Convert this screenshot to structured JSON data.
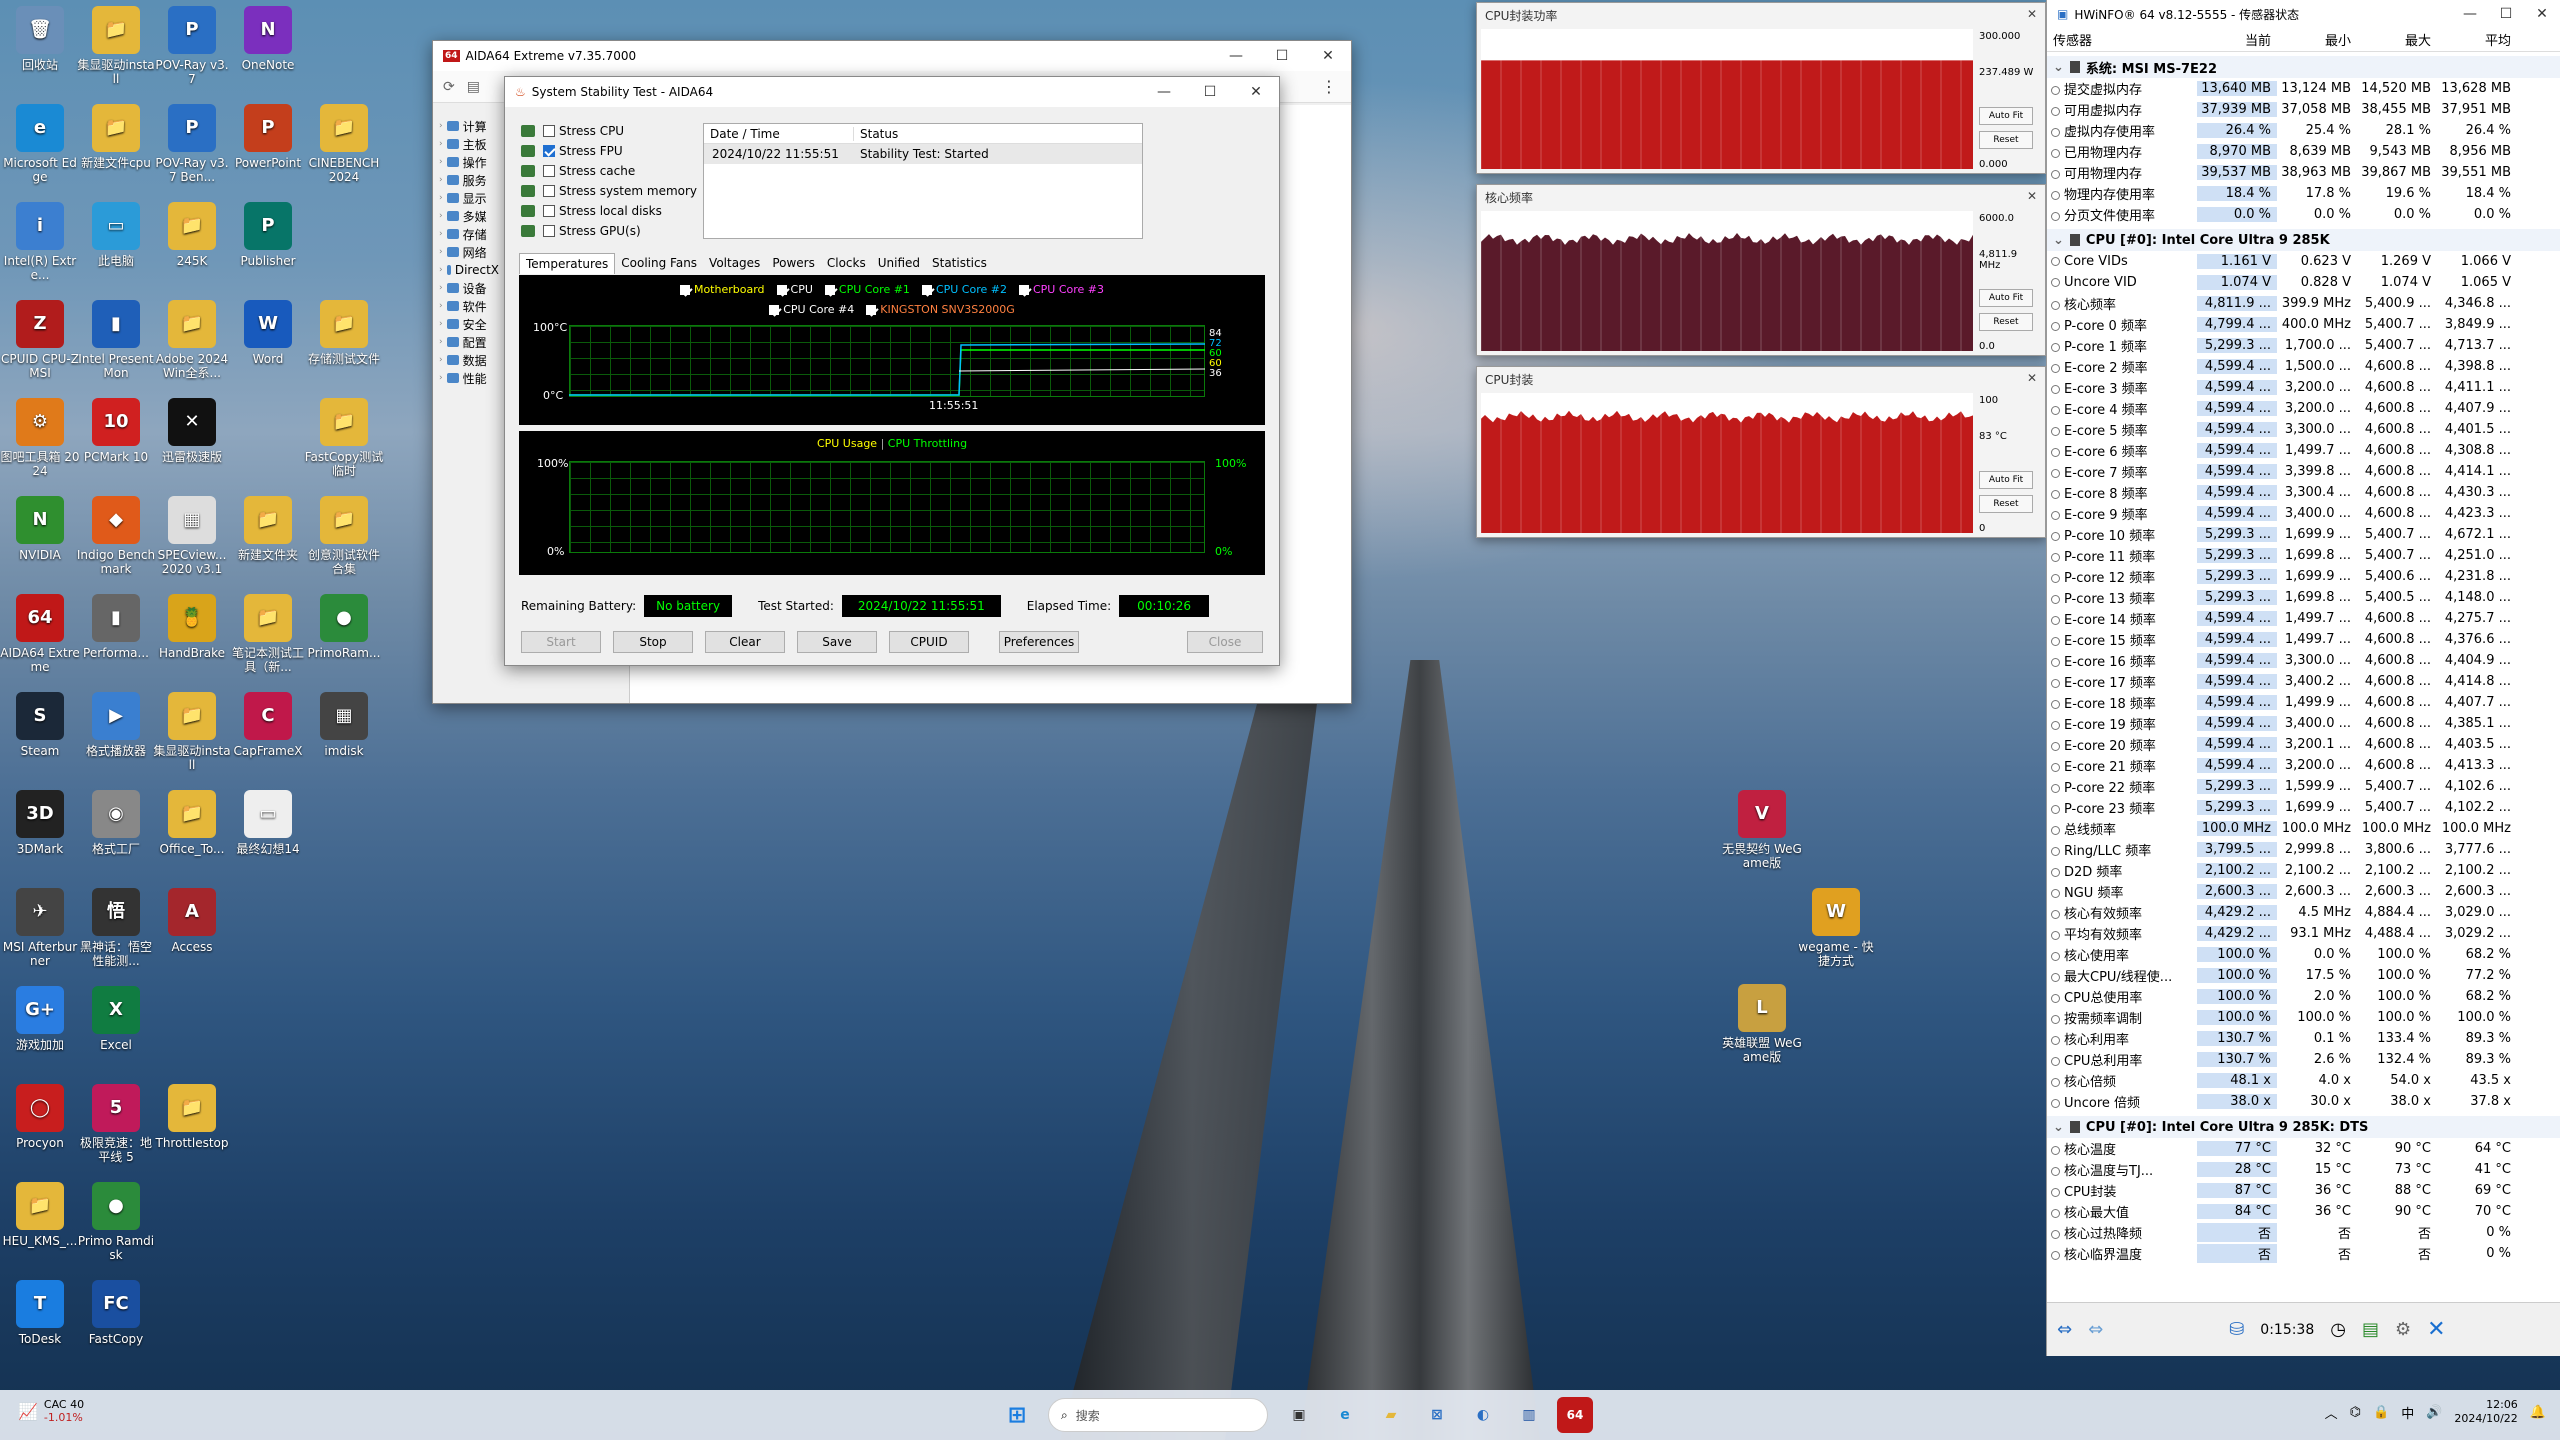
{
  "desktop_icons": [
    {
      "label": "回收站",
      "color": "#6a8fb8",
      "glyph": "🗑"
    },
    {
      "label": "集显驱动install",
      "color": "#e4b73a",
      "glyph": "📁"
    },
    {
      "label": "POV-Ray v3.7",
      "color": "#2a6fc4",
      "glyph": "P"
    },
    {
      "label": "OneNote",
      "color": "#7b2fbe",
      "glyph": "N"
    },
    {
      "label": "Microsoft Edge",
      "color": "#1a8ad4",
      "glyph": "e"
    },
    {
      "label": "新建文件cpu",
      "color": "#e4b73a",
      "glyph": "📁"
    },
    {
      "label": "POV-Ray v3.7 Ben...",
      "color": "#2a6fc4",
      "glyph": "P"
    },
    {
      "label": "PowerPoint",
      "color": "#c43e1c",
      "glyph": "P"
    },
    {
      "label": "CINEBENCH 2024",
      "color": "#e4b73a",
      "glyph": "📁"
    },
    {
      "label": "Intel(R) Extre...",
      "color": "#3c7fd0",
      "glyph": "i"
    },
    {
      "label": "此电脑",
      "color": "#2b9bd8",
      "glyph": "▭"
    },
    {
      "label": "245K",
      "color": "#e4b73a",
      "glyph": "📁"
    },
    {
      "label": "Publisher",
      "color": "#077568",
      "glyph": "P"
    },
    {
      "label": "CPUID CPU-Z MSI",
      "color": "#b11c1c",
      "glyph": "Z"
    },
    {
      "label": "Intel PresentMon",
      "color": "#1f5fb8",
      "glyph": "▮"
    },
    {
      "label": "Adobe 2024 Win全系...",
      "color": "#e4b73a",
      "glyph": "📁"
    },
    {
      "label": "Word",
      "color": "#185abd",
      "glyph": "W"
    },
    {
      "label": "存储测试文件",
      "color": "#e4b73a",
      "glyph": "📁"
    },
    {
      "label": "图吧工具箱 2024",
      "color": "#e07a1a",
      "glyph": "⚙"
    },
    {
      "label": "PCMark 10",
      "color": "#d02020",
      "glyph": "10"
    },
    {
      "label": "迅雷极速版",
      "color": "#111",
      "glyph": "✕"
    },
    {
      "label": "FastCopy测试临时",
      "color": "#e4b73a",
      "glyph": "📁"
    },
    {
      "label": "NVIDIA",
      "color": "#2f8f2f",
      "glyph": "N"
    },
    {
      "label": "Indigo Benchmark",
      "color": "#e05a1a",
      "glyph": "◆"
    },
    {
      "label": "SPECview... 2020 v3.1",
      "color": "#ddd",
      "glyph": "▦"
    },
    {
      "label": "新建文件夹",
      "color": "#e4b73a",
      "glyph": "📁"
    },
    {
      "label": "创意测试软件合集",
      "color": "#e4b73a",
      "glyph": "📁"
    },
    {
      "label": "AIDA64 Extreme",
      "color": "#c01818",
      "glyph": "64"
    },
    {
      "label": "Performa...",
      "color": "#666",
      "glyph": "▮"
    },
    {
      "label": "HandBrake",
      "color": "#d9a41a",
      "glyph": "🍍"
    },
    {
      "label": "笔记本测试工具（新...",
      "color": "#e4b73a",
      "glyph": "📁"
    },
    {
      "label": "PrimoRam...",
      "color": "#2b8b3b",
      "glyph": "●"
    },
    {
      "label": "Steam",
      "color": "#1b2838",
      "glyph": "S"
    },
    {
      "label": "格式播放器",
      "color": "#3a7fd0",
      "glyph": "▶"
    },
    {
      "label": "集显驱动install",
      "color": "#e4b73a",
      "glyph": "📁"
    },
    {
      "label": "CapFrameX",
      "color": "#c0184a",
      "glyph": "C"
    },
    {
      "label": "imdisk",
      "color": "#444",
      "glyph": "▦"
    },
    {
      "label": "3DMark",
      "color": "#222",
      "glyph": "3D"
    },
    {
      "label": "格式工厂",
      "color": "#888",
      "glyph": "◉"
    },
    {
      "label": "Office_To...",
      "color": "#e4b73a",
      "glyph": "📁"
    },
    {
      "label": "最终幻想14",
      "color": "#eee",
      "glyph": "▭"
    },
    {
      "label": "MSI Afterburner",
      "color": "#444",
      "glyph": "✈"
    },
    {
      "label": "黑神话：悟空 性能测...",
      "color": "#333",
      "glyph": "悟"
    },
    {
      "label": "Access",
      "color": "#a4262c",
      "glyph": "A"
    },
    {
      "label": "游戏加加",
      "color": "#2a7de1",
      "glyph": "G+"
    },
    {
      "label": "Excel",
      "color": "#107c41",
      "glyph": "X"
    },
    {
      "label": "Procyon",
      "color": "#c81e1e",
      "glyph": "◯"
    },
    {
      "label": "极限竞速：地平线 5",
      "color": "#c01a5a",
      "glyph": "5"
    },
    {
      "label": "Throttlestop",
      "color": "#e4b73a",
      "glyph": "📁"
    },
    {
      "label": "HEU_KMS_...",
      "color": "#e4b73a",
      "glyph": "📁"
    },
    {
      "label": "Primo Ramdisk",
      "color": "#2b8b3b",
      "glyph": "●"
    },
    {
      "label": "ToDesk",
      "color": "#1a7de0",
      "glyph": "T"
    },
    {
      "label": "FastCopy",
      "color": "#1a4fa0",
      "glyph": "FC"
    },
    {
      "label": "无畏契约 WeGame版",
      "color": "#c02040",
      "glyph": "V"
    },
    {
      "label": "wegame - 快捷方式",
      "color": "#e0a020",
      "glyph": "W"
    },
    {
      "label": "英雄联盟 WeGame版",
      "color": "#c8a040",
      "glyph": "L"
    }
  ],
  "aida_main": {
    "title": "AIDA64 Extreme v7.35.7000",
    "tree": [
      "计算",
      "主板",
      "操作",
      "服务",
      "显示",
      "多媒",
      "存储",
      "网络",
      "DirectX",
      "设备",
      "软件",
      "安全",
      "配置",
      "数据",
      "性能"
    ]
  },
  "stability": {
    "title": "System Stability Test - AIDA64",
    "stress": [
      {
        "label": "Stress CPU",
        "checked": false
      },
      {
        "label": "Stress FPU",
        "checked": true
      },
      {
        "label": "Stress cache",
        "checked": false
      },
      {
        "label": "Stress system memory",
        "checked": false
      },
      {
        "label": "Stress local disks",
        "checked": false
      },
      {
        "label": "Stress GPU(s)",
        "checked": false
      }
    ],
    "log_headers": {
      "date": "Date / Time",
      "status": "Status"
    },
    "log_rows": [
      {
        "date": "2024/10/22 11:55:51",
        "status": "Stability Test: Started"
      }
    ],
    "tabs": [
      "Temperatures",
      "Cooling Fans",
      "Voltages",
      "Powers",
      "Clocks",
      "Unified",
      "Statistics"
    ],
    "temp_legend": [
      {
        "label": "Motherboard",
        "color": "#ffff00"
      },
      {
        "label": "CPU",
        "color": "#ffffff"
      },
      {
        "label": "CPU Core #1",
        "color": "#00ff00"
      },
      {
        "label": "CPU Core #2",
        "color": "#00c0ff"
      },
      {
        "label": "CPU Core #3",
        "color": "#ff40ff"
      },
      {
        "label": "CPU Core #4",
        "color": "#ffffff"
      },
      {
        "label": "KINGSTON SNV3S2000G",
        "color": "#ff8040"
      }
    ],
    "temp_ymax": "100°C",
    "temp_ymin": "0°C",
    "temp_time": "11:55:51",
    "temp_values_right": [
      "84",
      "72",
      "60",
      "60",
      "36"
    ],
    "usage_title_a": "CPU Usage",
    "usage_sep": "|",
    "usage_title_b": "CPU Throttling",
    "usage_ymax_l": "100%",
    "usage_ymin_l": "0%",
    "usage_ymax_r": "100%",
    "usage_ymin_r": "0%",
    "remaining_battery_label": "Remaining Battery:",
    "remaining_battery": "No battery",
    "test_started_label": "Test Started:",
    "test_started": "2024/10/22 11:55:51",
    "elapsed_label": "Elapsed Time:",
    "elapsed": "00:10:26",
    "buttons": [
      "Start",
      "Stop",
      "Clear",
      "Save",
      "CPUID",
      "Preferences",
      "Close"
    ]
  },
  "graph_windows": [
    {
      "title": "CPU封装功率",
      "top": "300.000",
      "cur": "237.489 W",
      "bottom": "0.000",
      "fill": 0.79
    },
    {
      "title": "核心频率",
      "top": "6000.0",
      "cur": "4,811.9 MHz",
      "bottom": "0.0",
      "fill": 0.8
    },
    {
      "title": "CPU封装",
      "top": "100",
      "cur": "83 °C",
      "bottom": "0",
      "fill": 0.83
    }
  ],
  "graph_buttons": {
    "fit": "Auto Fit",
    "reset": "Reset"
  },
  "hwinfo": {
    "title": "HWiNFO® 64 v8.12-5555 - 传感器状态",
    "headers": [
      "传感器",
      "当前",
      "最小",
      "最大",
      "平均"
    ],
    "groups": [
      {
        "name": "系统: MSI MS-7E22",
        "rows": [
          [
            "提交虚拟内存",
            "13,640 MB",
            "13,124 MB",
            "14,520 MB",
            "13,628 MB"
          ],
          [
            "可用虚拟内存",
            "37,939 MB",
            "37,058 MB",
            "38,455 MB",
            "37,951 MB"
          ],
          [
            "虚拟内存使用率",
            "26.4 %",
            "25.4 %",
            "28.1 %",
            "26.4 %"
          ],
          [
            "已用物理内存",
            "8,970 MB",
            "8,639 MB",
            "9,543 MB",
            "8,956 MB"
          ],
          [
            "可用物理内存",
            "39,537 MB",
            "38,963 MB",
            "39,867 MB",
            "39,551 MB"
          ],
          [
            "物理内存使用率",
            "18.4 %",
            "17.8 %",
            "19.6 %",
            "18.4 %"
          ],
          [
            "分页文件使用率",
            "0.0 %",
            "0.0 %",
            "0.0 %",
            "0.0 %"
          ]
        ]
      },
      {
        "name": "CPU [#0]: Intel Core Ultra 9 285K",
        "rows": [
          [
            "Core VIDs",
            "1.161 V",
            "0.623 V",
            "1.269 V",
            "1.066 V"
          ],
          [
            "Uncore VID",
            "1.074 V",
            "0.828 V",
            "1.074 V",
            "1.065 V"
          ],
          [
            "核心频率",
            "4,811.9 ...",
            "399.9 MHz",
            "5,400.9 ...",
            "4,346.8 ..."
          ],
          [
            "P-core 0 频率",
            "4,799.4 ...",
            "400.0 MHz",
            "5,400.7 ...",
            "3,849.9 ..."
          ],
          [
            "P-core 1 频率",
            "5,299.3 ...",
            "1,700.0 ...",
            "5,400.7 ...",
            "4,713.7 ..."
          ],
          [
            "E-core 2 频率",
            "4,599.4 ...",
            "1,500.0 ...",
            "4,600.8 ...",
            "4,398.8 ..."
          ],
          [
            "E-core 3 频率",
            "4,599.4 ...",
            "3,200.0 ...",
            "4,600.8 ...",
            "4,411.1 ..."
          ],
          [
            "E-core 4 频率",
            "4,599.4 ...",
            "3,200.0 ...",
            "4,600.8 ...",
            "4,407.9 ..."
          ],
          [
            "E-core 5 频率",
            "4,599.4 ...",
            "3,300.0 ...",
            "4,600.8 ...",
            "4,401.5 ..."
          ],
          [
            "E-core 6 频率",
            "4,599.4 ...",
            "1,499.7 ...",
            "4,600.8 ...",
            "4,308.8 ..."
          ],
          [
            "E-core 7 频率",
            "4,599.4 ...",
            "3,399.8 ...",
            "4,600.8 ...",
            "4,414.1 ..."
          ],
          [
            "E-core 8 频率",
            "4,599.4 ...",
            "3,300.4 ...",
            "4,600.8 ...",
            "4,430.3 ..."
          ],
          [
            "E-core 9 频率",
            "4,599.4 ...",
            "3,400.0 ...",
            "4,600.8 ...",
            "4,423.3 ..."
          ],
          [
            "P-core 10 频率",
            "5,299.3 ...",
            "1,699.9 ...",
            "5,400.7 ...",
            "4,672.1 ..."
          ],
          [
            "P-core 11 频率",
            "5,299.3 ...",
            "1,699.8 ...",
            "5,400.7 ...",
            "4,251.0 ..."
          ],
          [
            "P-core 12 频率",
            "5,299.3 ...",
            "1,699.9 ...",
            "5,400.6 ...",
            "4,231.8 ..."
          ],
          [
            "P-core 13 频率",
            "5,299.3 ...",
            "1,699.8 ...",
            "5,400.5 ...",
            "4,148.0 ..."
          ],
          [
            "E-core 14 频率",
            "4,599.4 ...",
            "1,499.7 ...",
            "4,600.8 ...",
            "4,275.7 ..."
          ],
          [
            "E-core 15 频率",
            "4,599.4 ...",
            "1,499.7 ...",
            "4,600.8 ...",
            "4,376.6 ..."
          ],
          [
            "E-core 16 频率",
            "4,599.4 ...",
            "3,300.0 ...",
            "4,600.8 ...",
            "4,404.9 ..."
          ],
          [
            "E-core 17 频率",
            "4,599.4 ...",
            "3,400.2 ...",
            "4,600.8 ...",
            "4,414.8 ..."
          ],
          [
            "E-core 18 频率",
            "4,599.4 ...",
            "1,499.9 ...",
            "4,600.8 ...",
            "4,407.7 ..."
          ],
          [
            "E-core 19 频率",
            "4,599.4 ...",
            "3,400.0 ...",
            "4,600.8 ...",
            "4,385.1 ..."
          ],
          [
            "E-core 20 频率",
            "4,599.4 ...",
            "3,200.1 ...",
            "4,600.8 ...",
            "4,403.5 ..."
          ],
          [
            "E-core 21 频率",
            "4,599.4 ...",
            "3,200.0 ...",
            "4,600.8 ...",
            "4,413.3 ..."
          ],
          [
            "P-core 22 频率",
            "5,299.3 ...",
            "1,599.9 ...",
            "5,400.7 ...",
            "4,102.6 ..."
          ],
          [
            "P-core 23 频率",
            "5,299.3 ...",
            "1,699.9 ...",
            "5,400.7 ...",
            "4,102.2 ..."
          ],
          [
            "总线频率",
            "100.0 MHz",
            "100.0 MHz",
            "100.0 MHz",
            "100.0 MHz"
          ],
          [
            "Ring/LLC 频率",
            "3,799.5 ...",
            "2,999.8 ...",
            "3,800.6 ...",
            "3,777.6 ..."
          ],
          [
            "D2D 频率",
            "2,100.2 ...",
            "2,100.2 ...",
            "2,100.2 ...",
            "2,100.2 ..."
          ],
          [
            "NGU 频率",
            "2,600.3 ...",
            "2,600.3 ...",
            "2,600.3 ...",
            "2,600.3 ..."
          ],
          [
            "核心有效频率",
            "4,429.2 ...",
            "4.5 MHz",
            "4,884.4 ...",
            "3,029.0 ..."
          ],
          [
            "平均有效频率",
            "4,429.2 ...",
            "93.1 MHz",
            "4,488.4 ...",
            "3,029.2 ..."
          ],
          [
            "核心使用率",
            "100.0 %",
            "0.0 %",
            "100.0 %",
            "68.2 %"
          ],
          [
            "最大CPU/线程使...",
            "100.0 %",
            "17.5 %",
            "100.0 %",
            "77.2 %"
          ],
          [
            "CPU总使用率",
            "100.0 %",
            "2.0 %",
            "100.0 %",
            "68.2 %"
          ],
          [
            "按需频率调制",
            "100.0 %",
            "100.0 %",
            "100.0 %",
            "100.0 %"
          ],
          [
            "核心利用率",
            "130.7 %",
            "0.1 %",
            "133.4 %",
            "89.3 %"
          ],
          [
            "CPU总利用率",
            "130.7 %",
            "2.6 %",
            "132.4 %",
            "89.3 %"
          ],
          [
            "核心倍频",
            "48.1 x",
            "4.0 x",
            "54.0 x",
            "43.5 x"
          ],
          [
            "Uncore 倍频",
            "38.0 x",
            "30.0 x",
            "38.0 x",
            "37.8 x"
          ]
        ]
      },
      {
        "name": "CPU [#0]: Intel Core Ultra 9 285K: DTS",
        "rows": [
          [
            "核心温度",
            "77 °C",
            "32 °C",
            "90 °C",
            "64 °C"
          ],
          [
            "核心温度与TJ...",
            "28 °C",
            "15 °C",
            "73 °C",
            "41 °C"
          ],
          [
            "CPU封装",
            "87 °C",
            "36 °C",
            "88 °C",
            "69 °C"
          ],
          [
            "核心最大值",
            "84 °C",
            "36 °C",
            "90 °C",
            "70 °C"
          ],
          [
            "核心过热降频",
            "否",
            "否",
            "否",
            "0 %"
          ],
          [
            "核心临界温度",
            "否",
            "否",
            "否",
            "0 %"
          ]
        ]
      }
    ],
    "elapsed": "0:15:38"
  },
  "taskbar": {
    "weather_temp": "CAC 40",
    "weather_sub": "-1.01%",
    "search": "搜索",
    "time": "12:06",
    "date": "2024/10/22",
    "ime": "中"
  }
}
